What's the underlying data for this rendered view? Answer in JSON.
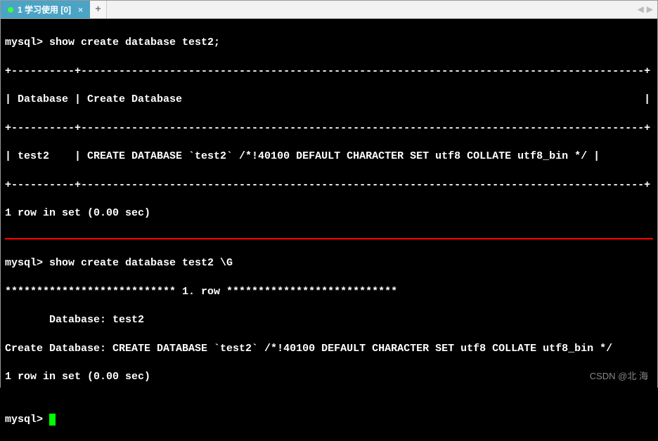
{
  "tab": {
    "title": "1 学习使用 [0]"
  },
  "terminal": {
    "block1": {
      "l0": "mysql> show create database test2;",
      "l1": "+----------+-----------------------------------------------------------------------------------------+",
      "l2": "| Database | Create Database                                                                         |",
      "l3": "+----------+-----------------------------------------------------------------------------------------+",
      "l4": "| test2    | CREATE DATABASE `test2` /*!40100 DEFAULT CHARACTER SET utf8 COLLATE utf8_bin */ |",
      "l5": "+----------+-----------------------------------------------------------------------------------------+",
      "l6": "1 row in set (0.00 sec)"
    },
    "block2": {
      "l0": "mysql> show create database test2 \\G",
      "l1": "*************************** 1. row ***************************",
      "l2": "       Database: test2",
      "l3": "Create Database: CREATE DATABASE `test2` /*!40100 DEFAULT CHARACTER SET utf8 COLLATE utf8_bin */",
      "l4": "1 row in set (0.00 sec)",
      "l5": "",
      "l6": "mysql> "
    }
  },
  "watermark": "CSDN @北   海"
}
